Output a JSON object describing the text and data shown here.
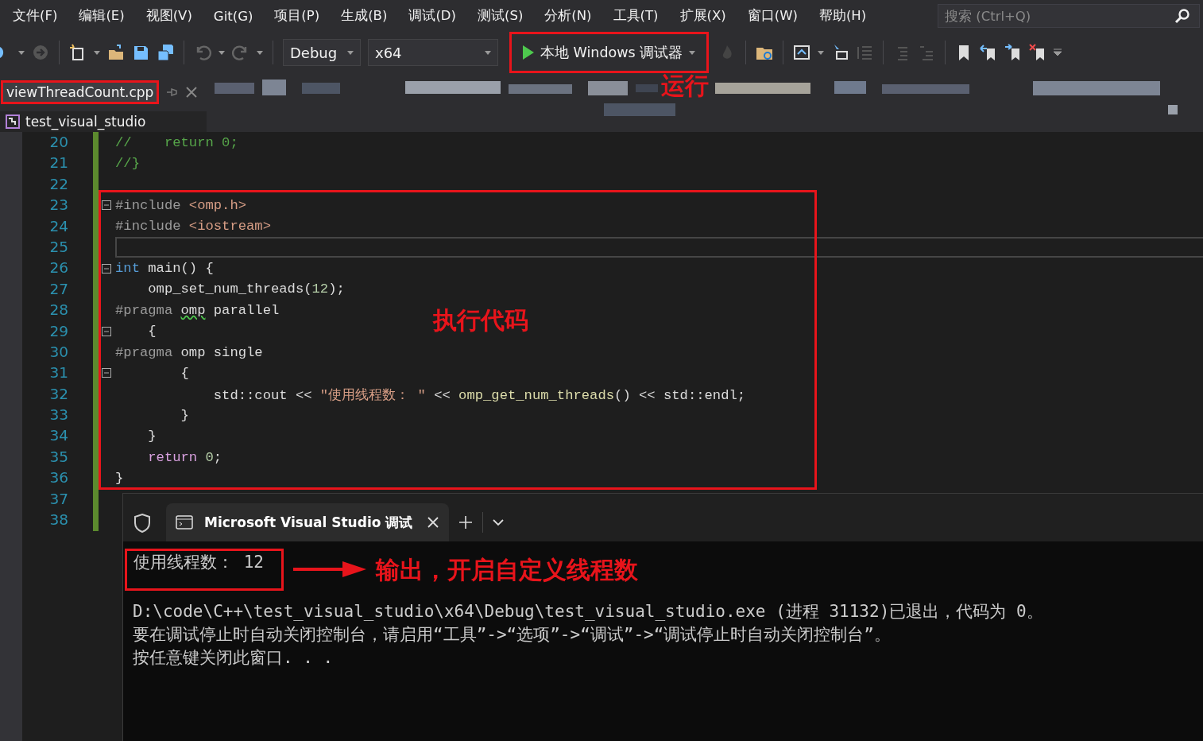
{
  "menu": [
    {
      "label": "文件(F)"
    },
    {
      "label": "编辑(E)"
    },
    {
      "label": "视图(V)"
    },
    {
      "label": "Git(G)"
    },
    {
      "label": "项目(P)"
    },
    {
      "label": "生成(B)"
    },
    {
      "label": "调试(D)"
    },
    {
      "label": "测试(S)"
    },
    {
      "label": "分析(N)"
    },
    {
      "label": "工具(T)"
    },
    {
      "label": "扩展(X)"
    },
    {
      "label": "窗口(W)"
    },
    {
      "label": "帮助(H)"
    }
  ],
  "search": {
    "placeholder": "搜索 (Ctrl+Q)"
  },
  "toolbar": {
    "configuration": "Debug",
    "platform": "x64",
    "run_button": "本地 Windows 调试器",
    "run_annotation": "运行"
  },
  "document_tab": {
    "title": "viewThreadCount.cpp"
  },
  "project": "test_visual_studio",
  "editor": {
    "lines_before": [
      {
        "number": "20",
        "fold": false,
        "tokens": [
          {
            "kind": "comment",
            "text": "//    return 0;"
          }
        ]
      },
      {
        "number": "21",
        "fold": false,
        "tokens": [
          {
            "kind": "comment",
            "text": "//}"
          }
        ]
      },
      {
        "number": "22",
        "fold": false
      }
    ],
    "highlighted_lines": [
      {
        "number": "23",
        "fold": true,
        "tokens": [
          {
            "kind": "preproc",
            "text": "#include "
          },
          {
            "kind": "string",
            "text": "<omp.h>"
          }
        ]
      },
      {
        "number": "24",
        "fold": false,
        "tokens": [
          {
            "kind": "preproc",
            "text": "#include "
          },
          {
            "kind": "string",
            "text": "<iostream>"
          }
        ]
      },
      {
        "number": "25",
        "fold": false,
        "current": true
      },
      {
        "number": "26",
        "fold": true,
        "tokens": [
          {
            "kind": "keyword",
            "text": "int"
          },
          {
            "kind": "plain",
            "text": " main() {"
          }
        ]
      },
      {
        "number": "27",
        "fold": false,
        "tokens": [
          {
            "kind": "plain",
            "text": "    omp_set_num_threads("
          },
          {
            "kind": "number",
            "text": "12"
          },
          {
            "kind": "plain",
            "text": ");"
          }
        ]
      },
      {
        "number": "28",
        "fold": false,
        "tokens": [
          {
            "kind": "preproc",
            "text": "#pragma "
          },
          {
            "kind": "squiggle",
            "text": "omp"
          },
          {
            "kind": "plain",
            "text": " parallel"
          }
        ]
      },
      {
        "number": "29",
        "fold": true,
        "tokens": [
          {
            "kind": "plain",
            "text": "    {"
          }
        ]
      },
      {
        "number": "30",
        "fold": false,
        "tokens": [
          {
            "kind": "preproc",
            "text": "#pragma "
          },
          {
            "kind": "plain",
            "text": "omp single"
          }
        ]
      },
      {
        "number": "31",
        "fold": true,
        "tokens": [
          {
            "kind": "plain",
            "text": "        {"
          }
        ]
      },
      {
        "number": "32",
        "fold": false,
        "tokens": [
          {
            "kind": "plain",
            "text": "            std::cout << "
          },
          {
            "kind": "string",
            "text": "\"使用线程数： \""
          },
          {
            "kind": "plain",
            "text": " << "
          },
          {
            "kind": "function",
            "text": "omp_get_num_threads"
          },
          {
            "kind": "plain",
            "text": "() << std::endl;"
          }
        ]
      },
      {
        "number": "33",
        "fold": false,
        "tokens": [
          {
            "kind": "plain",
            "text": "        }"
          }
        ]
      },
      {
        "number": "34",
        "fold": false,
        "tokens": [
          {
            "kind": "plain",
            "text": "    }"
          }
        ]
      },
      {
        "number": "35",
        "fold": false,
        "tokens": [
          {
            "kind": "control",
            "text": "    return"
          },
          {
            "kind": "number",
            "text": " 0"
          },
          {
            "kind": "plain",
            "text": ";"
          }
        ]
      },
      {
        "number": "36",
        "fold": false,
        "tokens": [
          {
            "kind": "plain",
            "text": "}"
          }
        ]
      }
    ],
    "lines_after": [
      {
        "number": "37",
        "fold": false
      },
      {
        "number": "38",
        "fold": false
      }
    ],
    "annotation": "执行代码"
  },
  "console": {
    "tab_title": "Microsoft Visual Studio 调试",
    "highlighted_output": "使用线程数： 12",
    "annotation": "输出，开启自定义线程数",
    "lines": [
      "D:\\code\\C++\\test_visual_studio\\x64\\Debug\\test_visual_studio.exe (进程 31132)已退出，代码为 0。",
      "要在调试停止时自动关闭控制台，请启用“工具”->“选项”->“调试”->“调试停止时自动关闭控制台”。",
      "按任意键关闭此窗口. . ."
    ]
  }
}
